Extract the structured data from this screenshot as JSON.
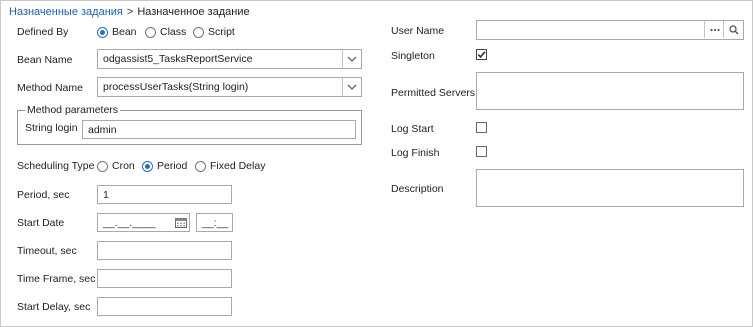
{
  "breadcrumb": {
    "parent": "Назначенные задания",
    "separator": ">",
    "current": "Назначенное задание"
  },
  "left": {
    "defined_by": {
      "label": "Defined By",
      "options": [
        "Bean",
        "Class",
        "Script"
      ],
      "selected": "Bean"
    },
    "bean_name": {
      "label": "Bean Name",
      "value": "odgassist5_TasksReportService"
    },
    "method_name": {
      "label": "Method Name",
      "value": "processUserTasks(String login)"
    },
    "method_params": {
      "legend": "Method parameters",
      "param_label": "String login",
      "param_value": "admin"
    },
    "scheduling_type": {
      "label": "Scheduling Type",
      "options": [
        "Cron",
        "Period",
        "Fixed Delay"
      ],
      "selected": "Period"
    },
    "period": {
      "label": "Period, sec",
      "value": "1"
    },
    "start_date": {
      "label": "Start Date",
      "date_value": "__.__.____",
      "time_value": "__:__"
    },
    "timeout": {
      "label": "Timeout, sec",
      "value": ""
    },
    "time_frame": {
      "label": "Time Frame, sec",
      "value": ""
    },
    "start_delay": {
      "label": "Start Delay, sec",
      "value": ""
    }
  },
  "right": {
    "user_name": {
      "label": "User Name",
      "value": "",
      "lookup_icon": "ellipsis-icon",
      "search_icon": "search-icon"
    },
    "singleton": {
      "label": "Singleton",
      "checked": true
    },
    "permitted_servers": {
      "label": "Permitted Servers",
      "value": ""
    },
    "log_start": {
      "label": "Log Start",
      "checked": false
    },
    "log_finish": {
      "label": "Log Finish",
      "checked": false
    },
    "description": {
      "label": "Description",
      "value": ""
    }
  },
  "colors": {
    "link": "#1f5fa8",
    "accent": "#2b6cb0",
    "border": "#a9a9a9"
  }
}
